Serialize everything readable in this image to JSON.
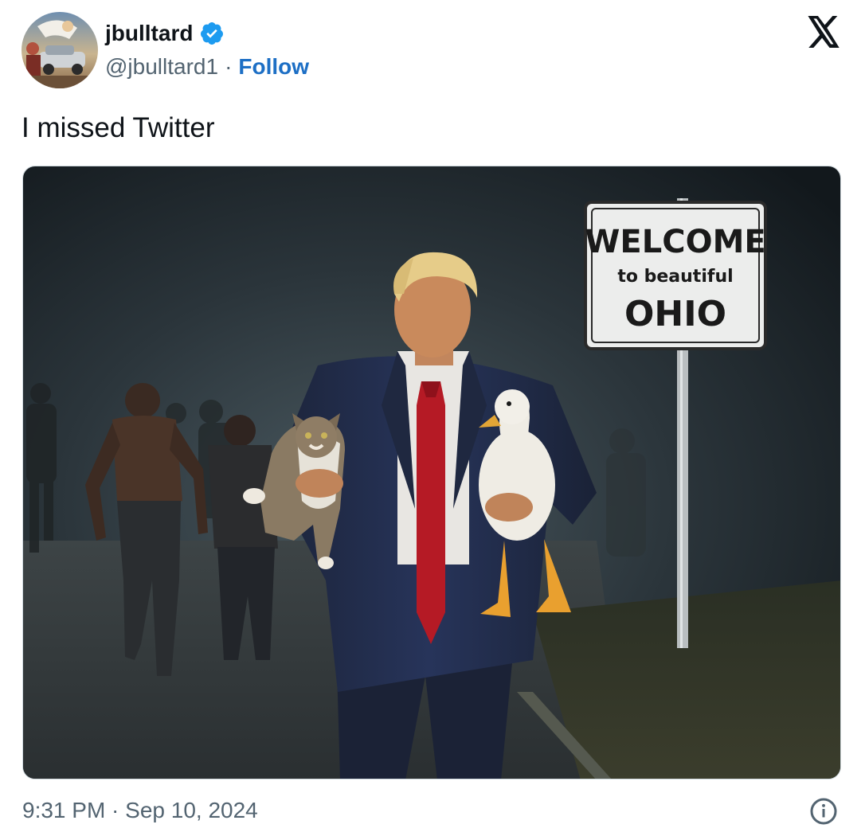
{
  "author": {
    "display_name": "jbulltard",
    "handle": "@jbulltard1",
    "separator": "·",
    "follow_label": "Follow",
    "verified_icon": "verified-badge-icon",
    "verified_color": "#1d9bf0"
  },
  "header": {
    "brand_icon": "x-logo-icon"
  },
  "tweet": {
    "text": "I missed Twitter",
    "timestamp": "9:31 PM · Sep 10, 2024",
    "info_icon": "info-icon"
  },
  "media": {
    "sign": {
      "line1": "WELCOME",
      "line2": "to beautiful",
      "line3": "OHIO"
    }
  },
  "colors": {
    "text_primary": "#0f1419",
    "text_secondary": "#536471",
    "link": "#1d6fc5",
    "border": "#cfd9de"
  }
}
